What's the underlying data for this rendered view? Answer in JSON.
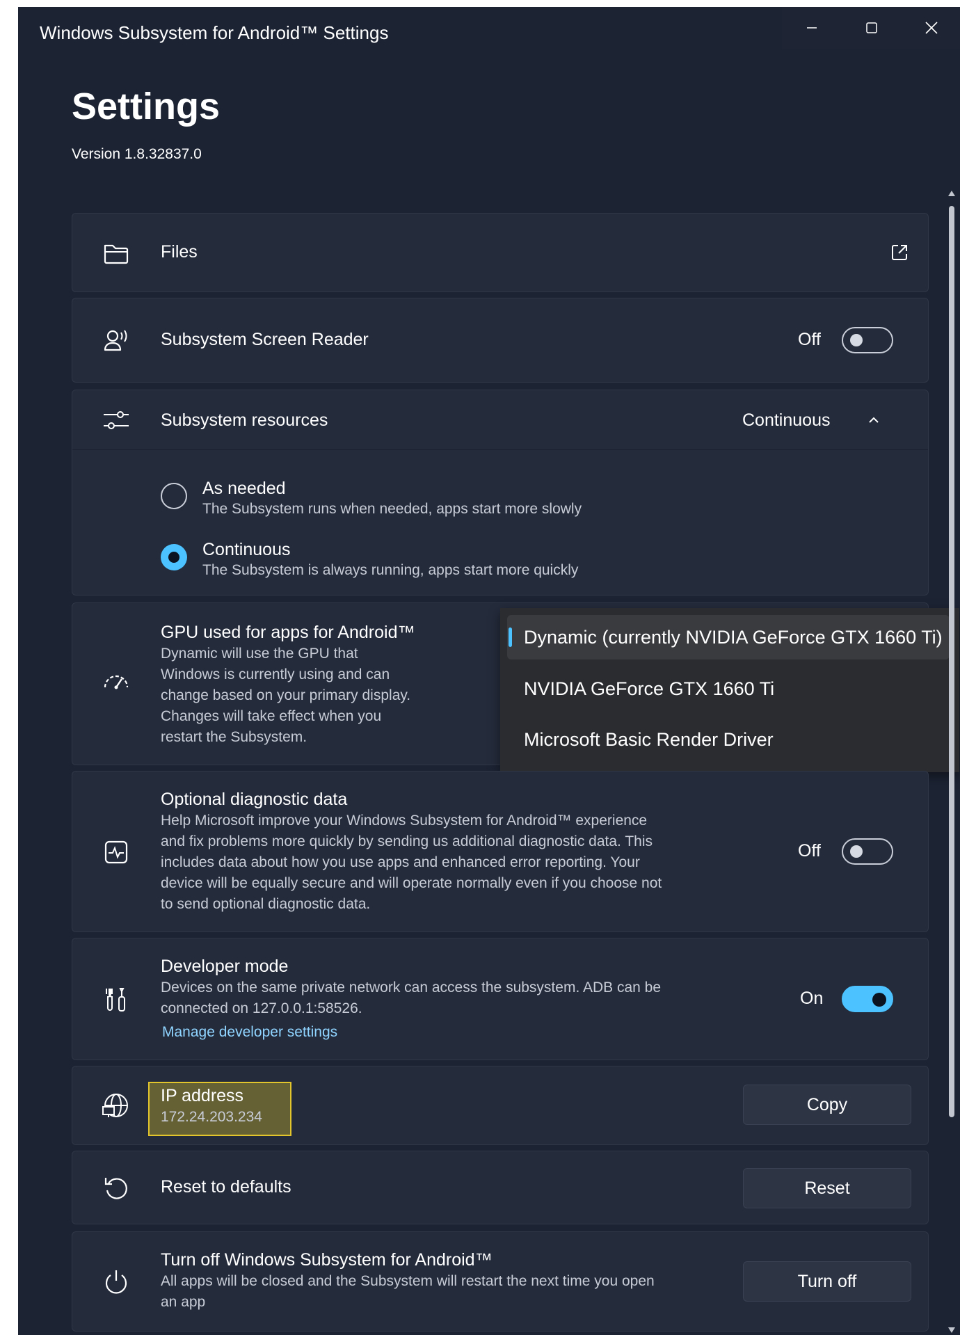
{
  "window": {
    "title": "Windows Subsystem for Android™ Settings",
    "controls": [
      "minimize-icon",
      "maximize-icon",
      "close-icon"
    ]
  },
  "header": {
    "title": "Settings",
    "version": "Version 1.8.32837.0"
  },
  "files": {
    "label": "Files",
    "icon": "folder-icon",
    "action_icon": "open-external-icon"
  },
  "screen_reader": {
    "label": "Subsystem Screen Reader",
    "icon": "screen-reader-icon",
    "state": "Off",
    "enabled": false
  },
  "resources": {
    "label": "Subsystem resources",
    "icon": "sliders-icon",
    "value": "Continuous",
    "expanded": true,
    "options": [
      {
        "title": "As needed",
        "description": "The Subsystem runs when needed, apps start more slowly",
        "selected": false
      },
      {
        "title": "Continuous",
        "description": "The Subsystem is always running, apps start more quickly",
        "selected": true
      }
    ]
  },
  "gpu": {
    "label": "GPU used for apps for Android™",
    "icon": "gauge-icon",
    "description_lines": [
      "Dynamic will use the GPU that",
      "Windows is currently using and can",
      "change based on your primary display.",
      "Changes will take effect when you",
      "restart the Subsystem."
    ],
    "options": [
      {
        "label": "Dynamic (currently NVIDIA GeForce GTX 1660 Ti)",
        "selected": true
      },
      {
        "label": "NVIDIA GeForce GTX 1660 Ti",
        "selected": false
      },
      {
        "label": "Microsoft Basic Render Driver",
        "selected": false
      }
    ]
  },
  "diagnostics": {
    "label": "Optional diagnostic data",
    "icon": "activity-icon",
    "description_lines": [
      "Help Microsoft improve your Windows Subsystem for Android™ experience",
      "and fix problems more quickly by sending us additional diagnostic data. This",
      "includes data about how you use apps and enhanced error reporting. Your",
      "device will be equally secure and will operate normally even if you choose not",
      "to send optional diagnostic data."
    ],
    "state": "Off",
    "enabled": false
  },
  "developer": {
    "label": "Developer mode",
    "icon": "tools-icon",
    "description_lines": [
      "Devices on the same private network can access the subsystem. ADB can be",
      "connected on 127.0.0.1:58526."
    ],
    "link": "Manage developer settings",
    "state": "On",
    "enabled": true
  },
  "ip": {
    "label": "IP address",
    "value": "172.24.203.234",
    "icon": "globe-network-icon",
    "button": "Copy",
    "highlight_color": "#e2c52c"
  },
  "reset": {
    "label": "Reset to defaults",
    "icon": "reset-icon",
    "button": "Reset"
  },
  "turn_off": {
    "label": "Turn off Windows Subsystem for Android™",
    "icon": "power-icon",
    "description_lines": [
      "All apps will be closed and the Subsystem will restart the next time you open",
      "an app"
    ],
    "button": "Turn off"
  },
  "colors": {
    "background": "#1c2333",
    "card": "#242b3b",
    "accent": "#4cc2ff",
    "link": "#8fd3ff"
  }
}
